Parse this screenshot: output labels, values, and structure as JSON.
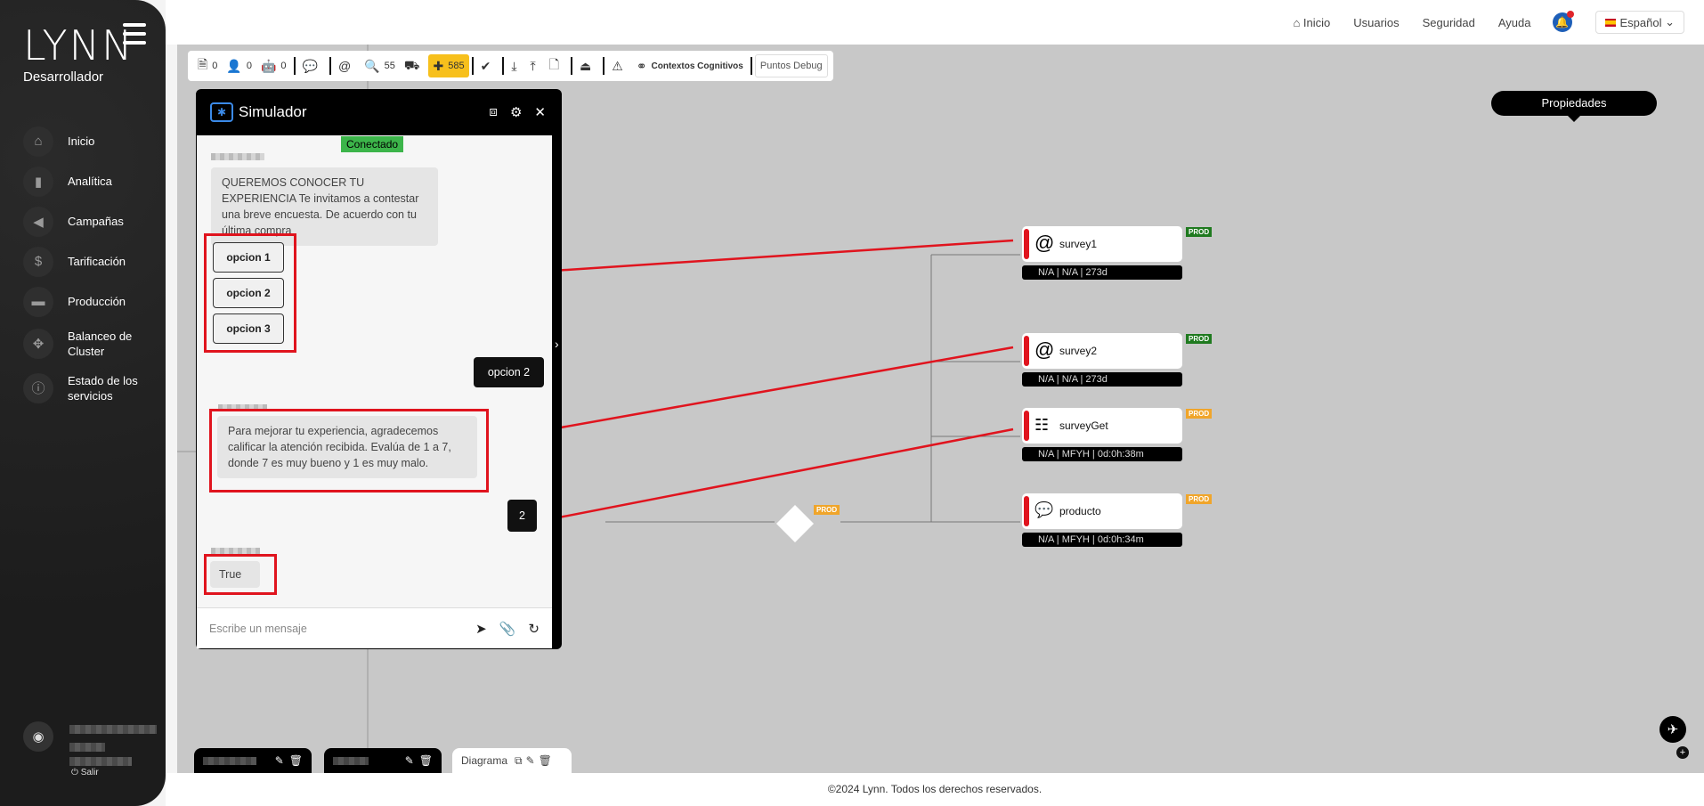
{
  "sidebar": {
    "logo": "LYNN",
    "role": "Desarrollador",
    "items": [
      {
        "label": "Inicio",
        "icon": "home-icon",
        "glyph": "⌂"
      },
      {
        "label": "Analítica",
        "icon": "bar-chart-icon",
        "glyph": "▮"
      },
      {
        "label": "Campañas",
        "icon": "megaphone-icon",
        "glyph": "◀"
      },
      {
        "label": "Tarificación",
        "icon": "dollar-icon",
        "glyph": "$"
      },
      {
        "label": "Producción",
        "icon": "briefcase-icon",
        "glyph": "▬"
      },
      {
        "label": "Balanceo de Cluster",
        "icon": "cluster-icon",
        "glyph": "✥"
      },
      {
        "label": "Estado de los servicios",
        "icon": "info-icon",
        "glyph": "ⓘ"
      }
    ],
    "logout": "⏻ Salir"
  },
  "topbar": {
    "links": [
      "Inicio",
      "Usuarios",
      "Seguridad",
      "Ayuda"
    ],
    "language": "Español"
  },
  "toolbar": {
    "counters": [
      "0",
      "0",
      "0",
      "55",
      "585"
    ],
    "cognitive": "Contextos Cognitivos",
    "debug": "Puntos Debug"
  },
  "properties_label": "Propiedades",
  "simulator": {
    "title": "Simulador",
    "status": "Conectado",
    "bot_message_1": "QUEREMOS CONOCER TU EXPERIENCIA Te invitamos a contestar una breve encuesta. De acuerdo con tu última compra",
    "options": [
      "opcion 1",
      "opcion 2",
      "opcion 3"
    ],
    "user_reply_1": "opcion 2",
    "bot_message_2": "Para mejorar tu experiencia, agradecemos calificar la atención recibida. Evalúa de 1 a 7, donde 7 es muy bueno y 1 es muy malo.",
    "user_reply_2": "2",
    "bot_message_3": "True",
    "input_placeholder": "Escribe un mensaje"
  },
  "nodes": [
    {
      "label": "survey1",
      "icon": "at-icon",
      "glyph": "@",
      "status": "N/A | N/A | 273d",
      "tag": "PROD",
      "tag_color": "#1f7a1f"
    },
    {
      "label": "survey2",
      "icon": "at-icon",
      "glyph": "@",
      "status": "N/A | N/A | 273d",
      "tag": "PROD",
      "tag_color": "#1f7a1f"
    },
    {
      "label": "surveyGet",
      "icon": "form-icon",
      "glyph": "☷",
      "status": "N/A | MFYH | 0d:0h:38m",
      "tag": "PROD",
      "tag_color": "#f0a52a"
    },
    {
      "label": "producto",
      "icon": "chat-icon",
      "glyph": "💬",
      "status": "N/A | MFYH | 0d:0h:34m",
      "tag": "PROD",
      "tag_color": "#f0a52a"
    }
  ],
  "diamond_tag": "PROD",
  "bottom_tabs": {
    "diagram": "Diagrama"
  },
  "footer": "©2024 Lynn. Todos los derechos reservados.",
  "colors": {
    "accent_red": "#e0141e",
    "toolbar_highlight": "#f7c01c",
    "status_green": "#3cb54a"
  }
}
